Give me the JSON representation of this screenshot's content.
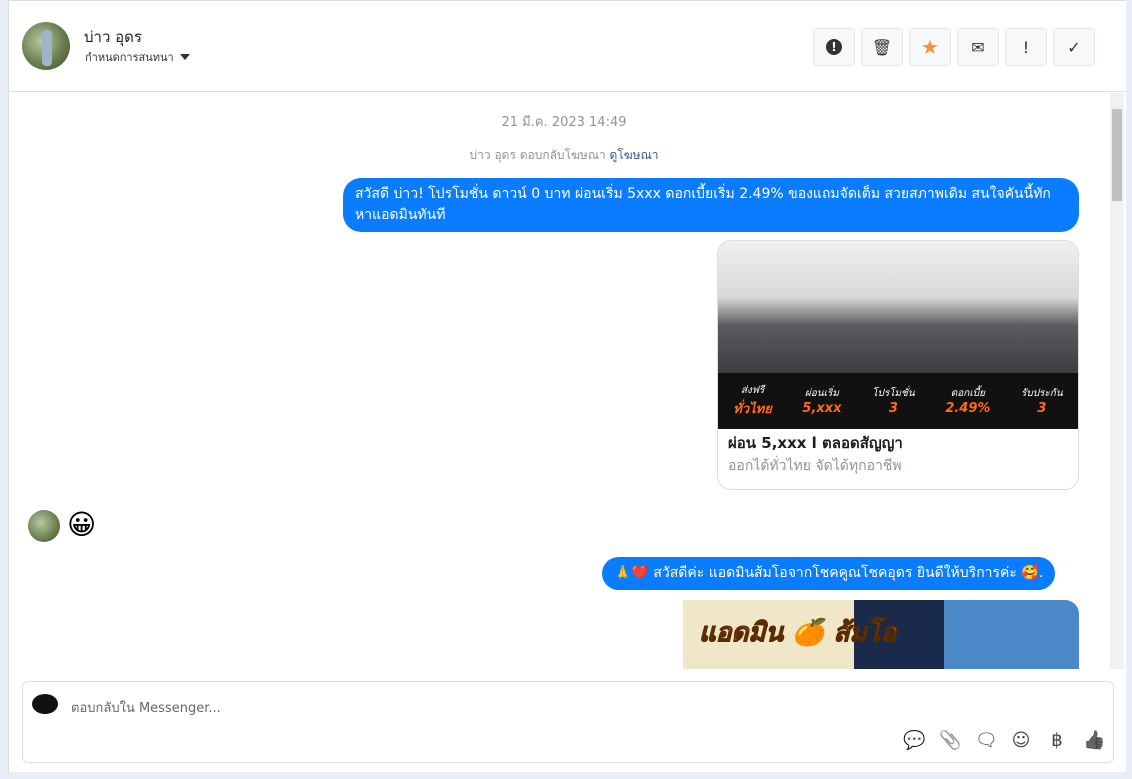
{
  "header": {
    "name": "บ่าว อุดร",
    "assign_label": "กำหนดการสนทนา",
    "tools": [
      {
        "icon": "alert-circle-icon",
        "glyph": "❗"
      },
      {
        "icon": "trash-icon",
        "glyph": "🗑"
      },
      {
        "icon": "star-icon",
        "glyph": "★"
      },
      {
        "icon": "envelope-icon",
        "glyph": "✉"
      },
      {
        "icon": "exclamation-icon",
        "glyph": "!"
      },
      {
        "icon": "check-icon",
        "glyph": "✓"
      }
    ]
  },
  "conversation": {
    "timestamp": "21 มี.ค. 2023 14:49",
    "replied_text": "บ่าว อุดร ตอบกลับโฆษณา",
    "view_ad_link": "ดูโฆษณา",
    "messages": [
      {
        "text": "สวัสดี บ่าว! โปรโมชั่น ดาวน์ 0 บาท ผ่อนเริ่ม 5xxx ดอกเบี้ยเริ่ม 2.49% ของแถมจัดเต็ม สวยสภาพเดิม สนใจคันนี้ทักหาแอดมินทันที"
      },
      {
        "card_title": "ผ่อน 5,xxx l ตลอดสัญญา",
        "card_subtitle": "ออกได้ทั่วไทย จัดได้ทุกอาชีพ",
        "promo": [
          {
            "label": "ส่งฟรี",
            "value": "ทั่วไทย"
          },
          {
            "label": "ผ่อนเริ่ม",
            "value": "5,xxx"
          },
          {
            "label": "โปรโมชั่น",
            "value": "3"
          },
          {
            "label": "ดอกเบี้ย",
            "value": "2.49%"
          },
          {
            "label": "รับประกัน",
            "value": "3"
          }
        ]
      },
      {
        "text": "😀"
      },
      {
        "text": "🙏❤️ สวัสดีค่ะ แอดมินส้มโอจากโชคคูณโชคอุดร ยินดีให้บริการค่ะ 🥰."
      },
      {
        "banner_text": "แอดมิน 🍊 ส้มโอ"
      }
    ]
  },
  "composer": {
    "placeholder": "ตอบกลับใน Messenger...",
    "icons": [
      {
        "icon": "saved-reply-icon",
        "glyph": "💬"
      },
      {
        "icon": "attachment-icon",
        "glyph": "📎"
      },
      {
        "icon": "chat-bubble-icon",
        "glyph": "🗨"
      },
      {
        "icon": "emoji-icon",
        "glyph": "☺"
      },
      {
        "icon": "baht-icon",
        "glyph": "฿"
      },
      {
        "icon": "thumbs-up-icon",
        "glyph": "👍"
      }
    ]
  },
  "colors": {
    "bubble": "#0a7cff",
    "star": "#f7923a"
  }
}
